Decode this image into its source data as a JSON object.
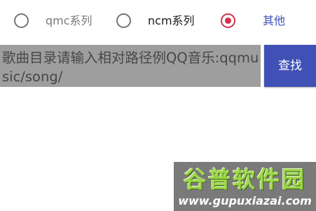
{
  "radio_group": {
    "options": [
      {
        "label": "qmc系列",
        "selected": false
      },
      {
        "label": "ncm系列",
        "selected": false
      },
      {
        "label": "其他",
        "selected": true
      }
    ]
  },
  "search": {
    "input_text": "歌曲目录请输入相对路径例QQ音乐:qqmusic/song/",
    "button_label": "查找"
  },
  "watermark": {
    "title": "谷普软件园",
    "url": "www.gupuxiazai.com"
  },
  "colors": {
    "accent": "#3f51b5",
    "radio_selected": "#d32f4f",
    "input_background": "#9e9e9e",
    "watermark_green": "#9fd84b"
  }
}
